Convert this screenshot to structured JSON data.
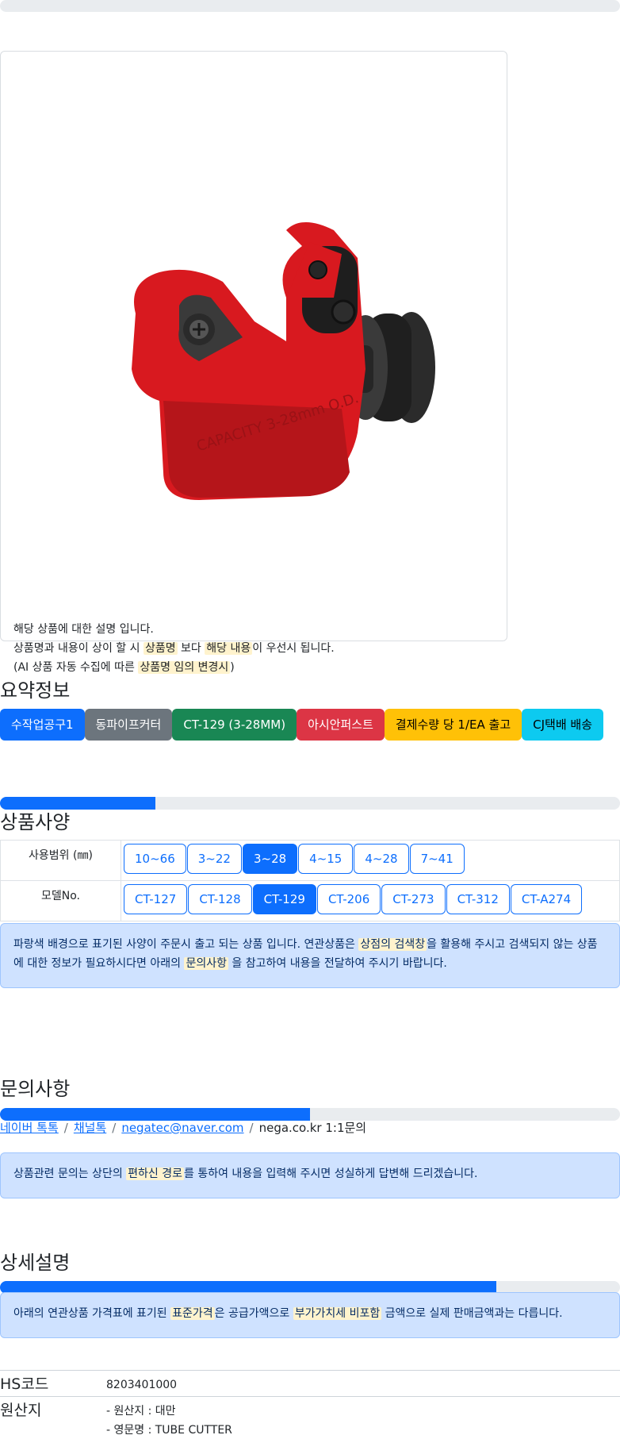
{
  "notice": {
    "line1": "해당 상품에 대한 설명 입니다.",
    "line2_a": "상품명과 내용이 상이 할 시 ",
    "line2_hl1": "상품명",
    "line2_b": " 보다 ",
    "line2_hl2": "해당 내용",
    "line2_c": "이 우선시 됩니다.",
    "line3_a": "(AI 상품 자동 수집에 따른 ",
    "line3_hl": "상품명 임의 변경시",
    "line3_b": ")"
  },
  "summary": {
    "title": "요약정보",
    "badges": [
      {
        "label": "수작업공구1",
        "color": "#0d6efd",
        "text_color": "#ffffff"
      },
      {
        "label": "동파이프커터",
        "color": "#6c757d",
        "text_color": "#ffffff"
      },
      {
        "label": "CT-129 (3-28MM)",
        "color": "#198754",
        "text_color": "#ffffff"
      },
      {
        "label": "아시안퍼스트",
        "color": "#dc3545",
        "text_color": "#ffffff"
      },
      {
        "label": "결제수량 당 1/EA 출고",
        "color": "#ffc107",
        "text_color": "#000000"
      },
      {
        "label": "CJ택배 배송",
        "color": "#0dcaf0",
        "text_color": "#000000"
      }
    ]
  },
  "spec": {
    "title": "상품사양",
    "progress": 0.25,
    "rows": [
      {
        "label": "사용범위 (㎜)",
        "options": [
          "10~66",
          "3~22",
          "3~28",
          "4~15",
          "4~28",
          "7~41"
        ],
        "selected": "3~28"
      },
      {
        "label": "모델No.",
        "options": [
          "CT-127",
          "CT-128",
          "CT-129",
          "CT-206",
          "CT-273",
          "CT-312",
          "CT-A274"
        ],
        "selected": "CT-129"
      }
    ],
    "alert_a": "파랑색 배경으로 표기된 사양이 주문시 출고 되는 상품 입니다. 연관상품은 ",
    "alert_hl1": "상점의 검색창",
    "alert_b": "을 활용해 주시고 검색되지 않는 상품에 대한 정보가 필요하시다면 아래의 ",
    "alert_hl2": "문의사항",
    "alert_c": " 을 참고하여 내용을 전달하여 주시기 바랍니다."
  },
  "inquiry": {
    "title": "문의사항",
    "progress": 0.5,
    "links": [
      "네이버 톡톡",
      "채널톡",
      "negatec@naver.com"
    ],
    "separator": "/",
    "plain": "nega.co.kr 1:1문의",
    "alert_a": "상품관련 문의는 상단의 ",
    "alert_hl": "편하신 경로",
    "alert_b": "를 통하여 내용을 입력해 주시면 성실하게 답변해 드리겠습니다."
  },
  "detail": {
    "title": "상세설명",
    "progress": 0.8,
    "alert_a": "아래의 연관상품 가격표에 표기된 ",
    "alert_hl1": "표준가격",
    "alert_b": "은 공급가액으로 ",
    "alert_hl2": "부가가치세 비포함",
    "alert_c": " 금액으로 실제 판매금액과는 다릅니다."
  },
  "info": {
    "hs_label": "HS코드",
    "hs_value": "8203401000",
    "origin_label": "원산지",
    "origin_line1": "- 원산지 : 대만",
    "origin_line2": "- 영문명 : TUBE CUTTER"
  }
}
